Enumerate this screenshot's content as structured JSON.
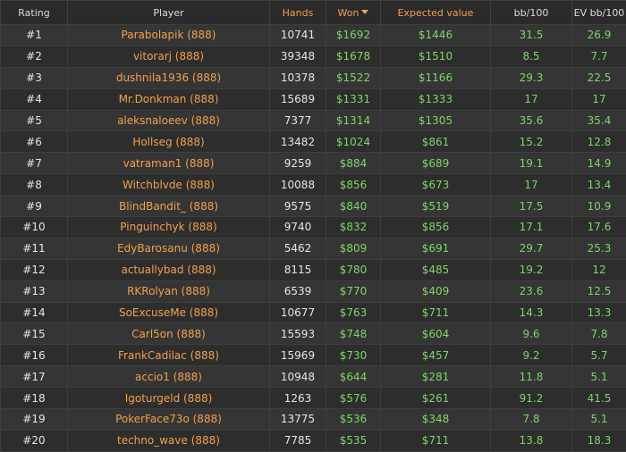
{
  "columns": {
    "rating": "Rating",
    "player": "Player",
    "hands": "Hands",
    "won": "Won",
    "expected": "Expected value",
    "bb100": "bb/100",
    "evbb100": "EV bb/100"
  },
  "colors": {
    "accent_orange": "#f2a04d",
    "value_green": "#7ed66a",
    "background": "#2b2b2b"
  },
  "icons": {
    "sort": "sort-descending-arrow-icon"
  },
  "rows": [
    {
      "rank": "#1",
      "player": "Parabolapik (888)",
      "hands": "10741",
      "won": "$1692",
      "expected": "$1446",
      "bb100": "31.5",
      "evbb100": "26.9"
    },
    {
      "rank": "#2",
      "player": "vitorarj (888)",
      "hands": "39348",
      "won": "$1678",
      "expected": "$1510",
      "bb100": "8.5",
      "evbb100": "7.7"
    },
    {
      "rank": "#3",
      "player": "dushnila1936 (888)",
      "hands": "10378",
      "won": "$1522",
      "expected": "$1166",
      "bb100": "29.3",
      "evbb100": "22.5"
    },
    {
      "rank": "#4",
      "player": "Mr.Donkman (888)",
      "hands": "15689",
      "won": "$1331",
      "expected": "$1333",
      "bb100": "17",
      "evbb100": "17"
    },
    {
      "rank": "#5",
      "player": "aleksnaloeev (888)",
      "hands": "7377",
      "won": "$1314",
      "expected": "$1305",
      "bb100": "35.6",
      "evbb100": "35.4"
    },
    {
      "rank": "#6",
      "player": "Hollseg (888)",
      "hands": "13482",
      "won": "$1024",
      "expected": "$861",
      "bb100": "15.2",
      "evbb100": "12.8"
    },
    {
      "rank": "#7",
      "player": "vatraman1 (888)",
      "hands": "9259",
      "won": "$884",
      "expected": "$689",
      "bb100": "19.1",
      "evbb100": "14.9"
    },
    {
      "rank": "#8",
      "player": "Witchblvde (888)",
      "hands": "10088",
      "won": "$856",
      "expected": "$673",
      "bb100": "17",
      "evbb100": "13.4"
    },
    {
      "rank": "#9",
      "player": "BlindBandit_ (888)",
      "hands": "9575",
      "won": "$840",
      "expected": "$519",
      "bb100": "17.5",
      "evbb100": "10.9"
    },
    {
      "rank": "#10",
      "player": "Pinguinchyk (888)",
      "hands": "9740",
      "won": "$832",
      "expected": "$856",
      "bb100": "17.1",
      "evbb100": "17.6"
    },
    {
      "rank": "#11",
      "player": "EdyBarosanu (888)",
      "hands": "5462",
      "won": "$809",
      "expected": "$691",
      "bb100": "29.7",
      "evbb100": "25.3"
    },
    {
      "rank": "#12",
      "player": "actuallybad (888)",
      "hands": "8115",
      "won": "$780",
      "expected": "$485",
      "bb100": "19.2",
      "evbb100": "12"
    },
    {
      "rank": "#13",
      "player": "RKRolyan (888)",
      "hands": "6539",
      "won": "$770",
      "expected": "$409",
      "bb100": "23.6",
      "evbb100": "12.5"
    },
    {
      "rank": "#14",
      "player": "SoExcuseMe (888)",
      "hands": "10677",
      "won": "$763",
      "expected": "$711",
      "bb100": "14.3",
      "evbb100": "13.3"
    },
    {
      "rank": "#15",
      "player": "Carl5on (888)",
      "hands": "15593",
      "won": "$748",
      "expected": "$604",
      "bb100": "9.6",
      "evbb100": "7.8"
    },
    {
      "rank": "#16",
      "player": "FrankCadilac (888)",
      "hands": "15969",
      "won": "$730",
      "expected": "$457",
      "bb100": "9.2",
      "evbb100": "5.7"
    },
    {
      "rank": "#17",
      "player": "accio1 (888)",
      "hands": "10948",
      "won": "$644",
      "expected": "$281",
      "bb100": "11.8",
      "evbb100": "5.1"
    },
    {
      "rank": "#18",
      "player": "Igoturgeld (888)",
      "hands": "1263",
      "won": "$576",
      "expected": "$261",
      "bb100": "91.2",
      "evbb100": "41.5"
    },
    {
      "rank": "#19",
      "player": "PokerFace73o (888)",
      "hands": "13775",
      "won": "$536",
      "expected": "$348",
      "bb100": "7.8",
      "evbb100": "5.1"
    },
    {
      "rank": "#20",
      "player": "techno_wave (888)",
      "hands": "7785",
      "won": "$535",
      "expected": "$711",
      "bb100": "13.8",
      "evbb100": "18.3"
    }
  ]
}
